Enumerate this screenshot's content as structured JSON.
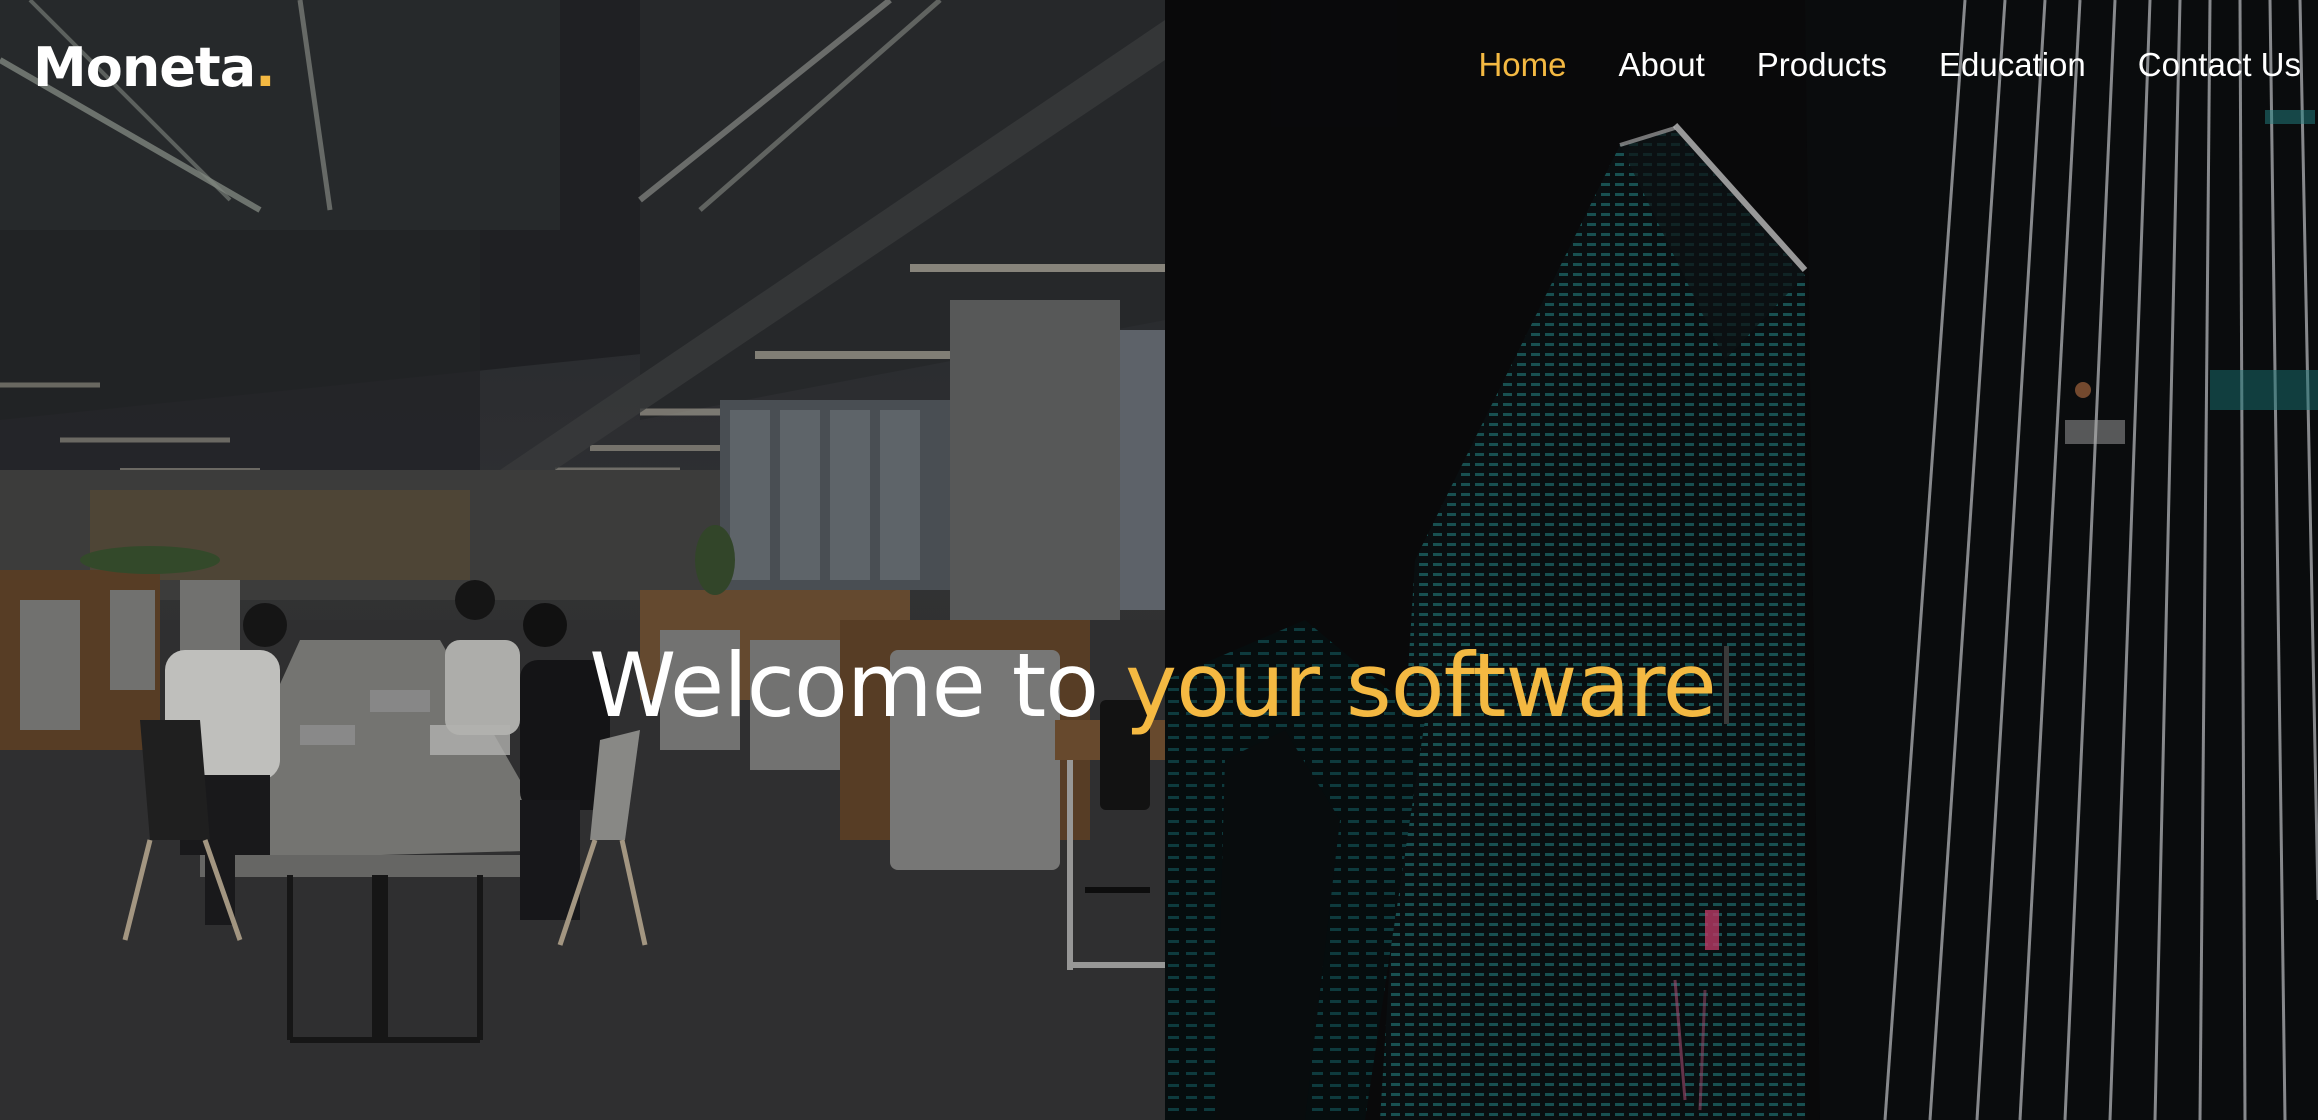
{
  "brand": {
    "name": "Moneta",
    "dot": ".",
    "accent_color": "#f4b942"
  },
  "nav": {
    "items": [
      {
        "label": "Home",
        "active": true
      },
      {
        "label": "About",
        "active": false
      },
      {
        "label": "Products",
        "active": false
      },
      {
        "label": "Education",
        "active": false
      },
      {
        "label": "Contact Us",
        "active": false
      }
    ]
  },
  "hero": {
    "headline_plain": "Welcome to ",
    "headline_accent": "your software",
    "text_color": "#ffffff"
  }
}
